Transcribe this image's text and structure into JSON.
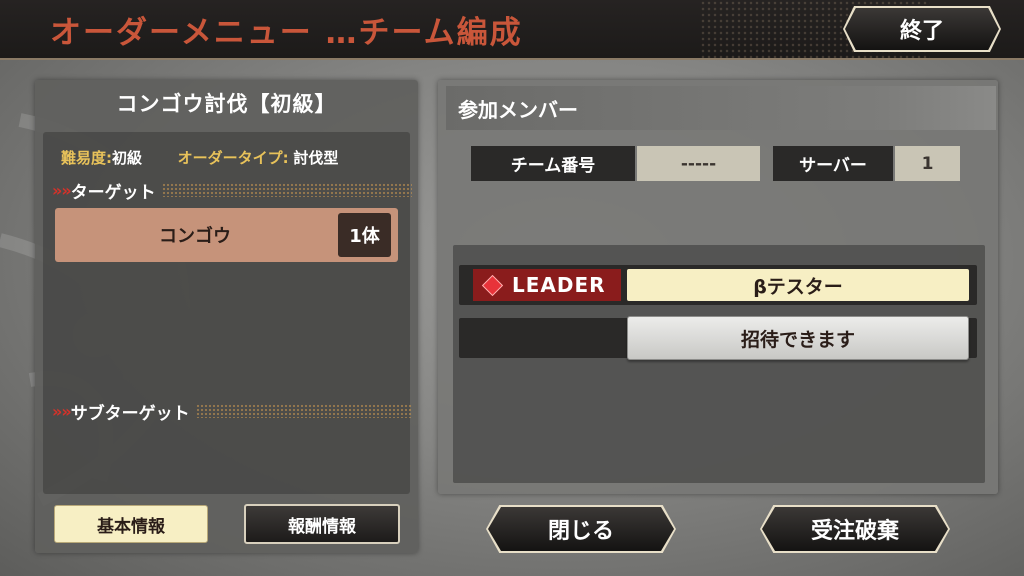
{
  "header": {
    "title": "オーダーメニュー …チーム編成",
    "end_label": "終了"
  },
  "quest": {
    "title": "コンゴウ討伐【初級】",
    "difficulty_key": "難易度:",
    "difficulty_val": "初級",
    "order_type_key": "オーダータイプ:",
    "order_type_val": "討伐型",
    "target_header": "ターゲット",
    "subtarget_header": "サブターゲット",
    "chevron": "»",
    "targets": [
      {
        "name": "コンゴウ",
        "count": "1体"
      }
    ]
  },
  "tabs": {
    "basic_info": "基本情報",
    "reward_info": "報酬情報"
  },
  "members": {
    "title": "参加メンバー",
    "team_number_label": "チーム番号",
    "team_number_value": "-----",
    "server_label": "サーバー",
    "server_value": "1",
    "leader_badge": "LEADER",
    "leader_name": "βテスター",
    "invite_label": "招待できます"
  },
  "footer": {
    "close_label": "閉じる",
    "cancel_order_label": "受注破棄"
  },
  "colors": {
    "title_red": "#c9563a",
    "gold": "#e8c25a",
    "target_bg": "#c6937a",
    "leader_red": "#8a1c1c"
  }
}
